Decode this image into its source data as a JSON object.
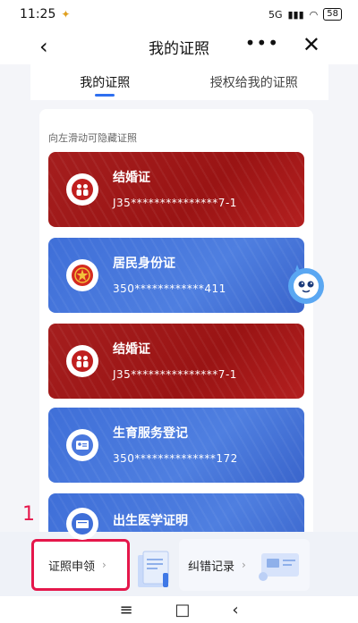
{
  "status": {
    "time": "11:25",
    "network": "5G",
    "battery": "58"
  },
  "nav": {
    "title": "我的证照"
  },
  "tabs": [
    {
      "label": "我的证照"
    },
    {
      "label": "授权给我的证照"
    }
  ],
  "hint": "向左滑动可隐藏证照",
  "certs": [
    {
      "title": "结婚证",
      "number": "J35***************7-1",
      "color": "#a51e1e",
      "icon": "couple-icon"
    },
    {
      "title": "居民身份证",
      "number": "350************411",
      "color": "#4570d8",
      "icon": "national-emblem-icon"
    },
    {
      "title": "结婚证",
      "number": "J35***************7-1",
      "color": "#a51e1e",
      "icon": "couple-icon"
    },
    {
      "title": "生育服务登记",
      "number": "350**************172",
      "color": "#4570d8",
      "icon": "id-card-icon"
    },
    {
      "title": "出生医学证明",
      "number": "",
      "color": "#3f6fd8",
      "icon": "certificate-icon"
    }
  ],
  "actions": {
    "apply_label": "证照申领",
    "correct_label": "纠错记录"
  },
  "annotation": "1"
}
